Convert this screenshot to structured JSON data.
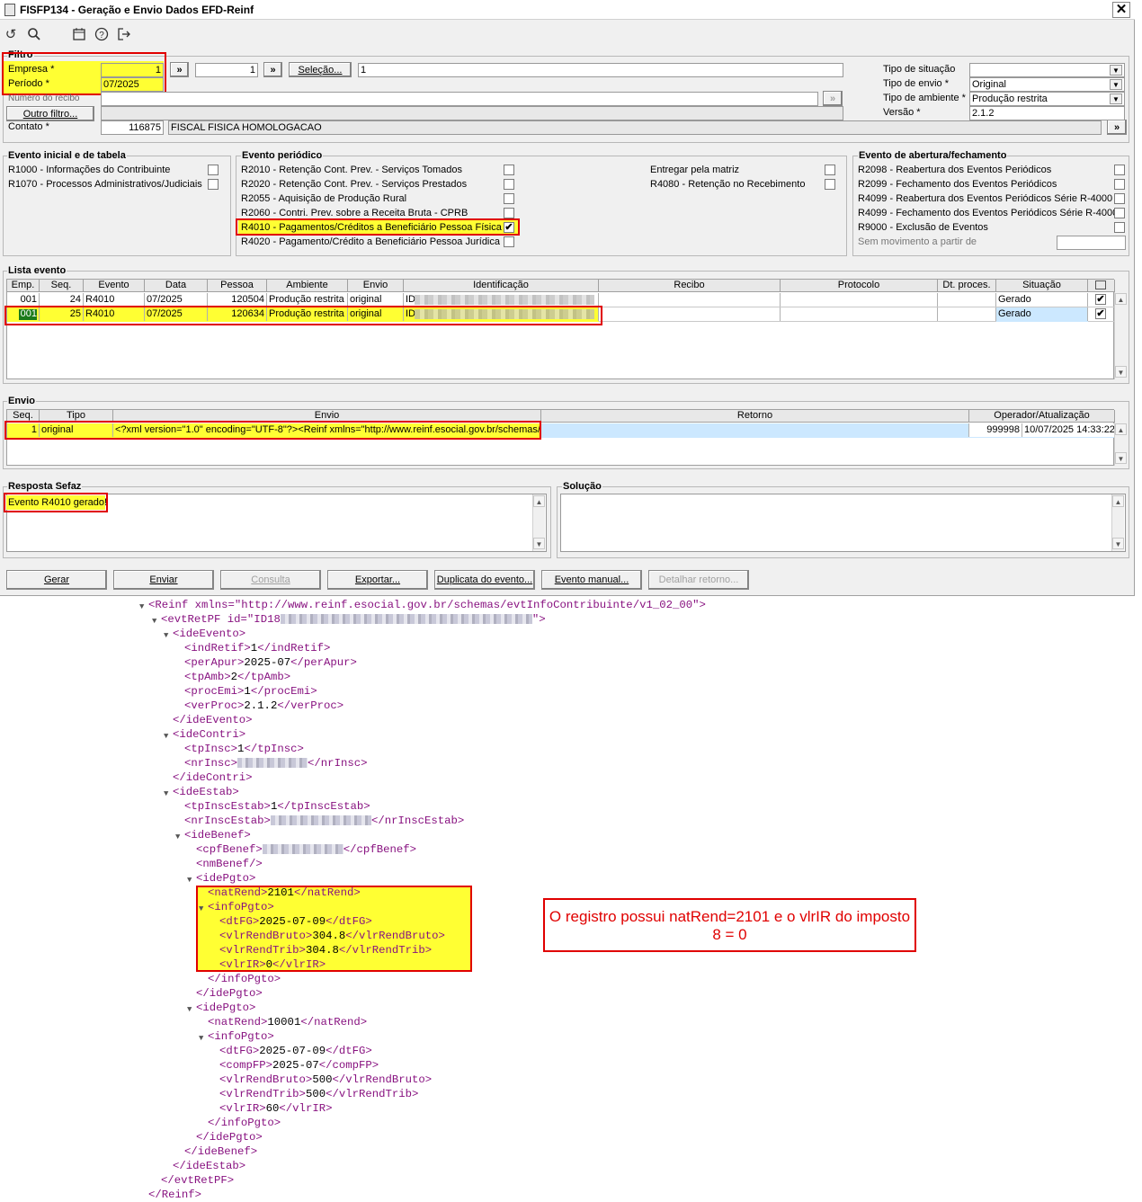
{
  "window": {
    "title": "FISFP134 - Geração e Envio Dados EFD-Reinf",
    "close": "✕"
  },
  "toolbar": [
    "undo-icon",
    "search-icon",
    "calendar-icon",
    "help-icon",
    "exit-icon"
  ],
  "filtro": {
    "label": "Filtro",
    "empresa_label": "Empresa *",
    "empresa_value": "1",
    "empresa2_value": "1",
    "periodo_label": "Período *",
    "periodo_value": "07/2025",
    "numero_recibo_label": "Número do recibo",
    "selecao_label": "Seleção...",
    "selecao_value": "1",
    "outro_filtro_label": "Outro filtro...",
    "contato_label": "Contato *",
    "contato_value": "116875",
    "contato_nome": "FISCAL FISICA HOMOLOGACAO",
    "tipo_situacao_label": "Tipo de situação",
    "tipo_situacao_value": "",
    "tipo_envio_label": "Tipo de envio *",
    "tipo_envio_value": "Original",
    "tipo_ambiente_label": "Tipo de ambiente *",
    "tipo_ambiente_value": "Produção restrita",
    "versao_label": "Versão *",
    "versao_value": "2.1.2",
    "nav_next": "»"
  },
  "evento_inicial": {
    "label": "Evento inicial e de tabela",
    "items": [
      "R1000 - Informações do Contribuinte",
      "R1070 - Processos Administrativos/Judiciais"
    ]
  },
  "evento_periodico": {
    "label": "Evento periódico",
    "items": [
      "R2010 - Retenção Cont. Prev. - Serviços Tomados",
      "R2020 - Retenção Cont. Prev. - Serviços Prestados",
      "R2055 - Aquisição de Produção Rural",
      "R2060 - Contri. Prev. sobre a Receita Bruta - CPRB",
      "R4010 - Pagamentos/Créditos a Beneficiário Pessoa Física",
      "R4020 - Pagamento/Crédito a Beneficiário Pessoa Jurídica"
    ],
    "right_items": [
      "Entregar pela matriz",
      "R4080 - Retenção no Recebimento"
    ],
    "check_mark": "✔"
  },
  "evento_abertura": {
    "label": "Evento de abertura/fechamento",
    "items": [
      "R2098 - Reabertura dos Eventos Periódicos",
      "R2099 - Fechamento dos Eventos Periódicos",
      "R4099 - Reabertura dos Eventos Periódicos Série R-4000",
      "R4099 - Fechamento dos Eventos Periódicos Série R-4000",
      "R9000 - Exclusão de Eventos"
    ],
    "sem_movimento_label": "Sem movimento a partir de"
  },
  "lista_evento": {
    "label": "Lista evento",
    "columns": [
      "Emp.",
      "Seq.",
      "Evento",
      "Data",
      "Pessoa",
      "Ambiente",
      "Envio",
      "Identificação",
      "Recibo",
      "Protocolo",
      "Dt. proces.",
      "Situação"
    ],
    "rows": [
      [
        "001",
        "24",
        "R4010",
        "07/2025",
        "120504",
        "Produção restrita",
        "original",
        "ID",
        "",
        "",
        "",
        "Gerado"
      ],
      [
        "001",
        "25",
        "R4010",
        "07/2025",
        "120634",
        "Produção restrita",
        "original",
        "ID",
        "",
        "",
        "",
        "Gerado"
      ]
    ]
  },
  "envio": {
    "label": "Envio",
    "columns": [
      "Seq.",
      "Tipo",
      "Envio",
      "Retorno",
      "Operador/Atualização"
    ],
    "row": [
      "1",
      "original",
      "<?xml version=\"1.0\" encoding=\"UTF-8\"?><Reinf xmlns=\"http://www.reinf.esocial.gov.br/schemas/",
      "",
      "999998",
      "10/07/2025 14:33:22"
    ]
  },
  "resposta": {
    "label": "Resposta Sefaz",
    "value": "Evento R4010 gerado!"
  },
  "solucao": {
    "label": "Solução"
  },
  "buttons": [
    "Gerar",
    "Enviar",
    "Consulta",
    "Exportar...",
    "Duplicata do evento...",
    "Evento manual...",
    "Detalhar retorno..."
  ],
  "xml_lines": [
    "<Reinf xmlns=\"http://www.reinf.esocial.gov.br/schemas/evtInfoContribuinte/v1_02_00\">",
    "<evtRetPF id=\"ID18",
    "\">",
    "<ideEvento>",
    "<indRetif>",
    "1",
    "</indRetif>",
    "<perApur>",
    "2025-07",
    "</perApur>",
    "<tpAmb>",
    "2",
    "</tpAmb>",
    "<procEmi>",
    "1",
    "</procEmi>",
    "<verProc>",
    "2.1.2",
    "</verProc>",
    "</ideEvento>",
    "<ideContri>",
    "<tpInsc>",
    "1",
    "</tpInsc>",
    "<nrInsc>",
    "</nrInsc>",
    "</ideContri>",
    "<ideEstab>",
    "<tpInscEstab>",
    "1",
    "</tpInscEstab>",
    "<nrInscEstab>",
    "</nrInscEstab>",
    "<ideBenef>",
    "<cpfBenef>",
    "</cpfBenef>",
    "<nmBenef/>",
    "<idePgto>",
    "<natRend>",
    "2101",
    "</natRend>",
    "<infoPgto>",
    "<dtFG>",
    "2025-07-09",
    "</dtFG>",
    "<vlrRendBruto>",
    "304.8",
    "</vlrRendBruto>",
    "<vlrRendTrib>",
    "304.8",
    "</vlrRendTrib>",
    "<vlrIR>",
    "0",
    "</vlrIR>",
    "</infoPgto>",
    "</idePgto>",
    "<idePgto>",
    "<natRend>",
    "10001",
    "</natRend>",
    "<infoPgto>",
    "<dtFG>",
    "2025-07-09",
    "</dtFG>",
    "<compFP>",
    "2025-07",
    "</compFP>",
    "<vlrRendBruto>",
    "500",
    "</vlrRendBruto>",
    "<vlrRendTrib>",
    "500",
    "</vlrRendTrib>",
    "<vlrIR>",
    "60",
    "</vlrIR>",
    "</infoPgto>",
    "</idePgto>",
    "</ideBenef>",
    "</ideEstab>",
    "</evtRetPF>",
    "</Reinf>"
  ],
  "note": "O registro possui natRend=2101 e o vlrIR do imposto 8 = 0",
  "colors": {
    "highlight": "#ffff33",
    "annotation": "#e00000",
    "selection": "#cce8ff",
    "xml_tag": "#881280"
  }
}
